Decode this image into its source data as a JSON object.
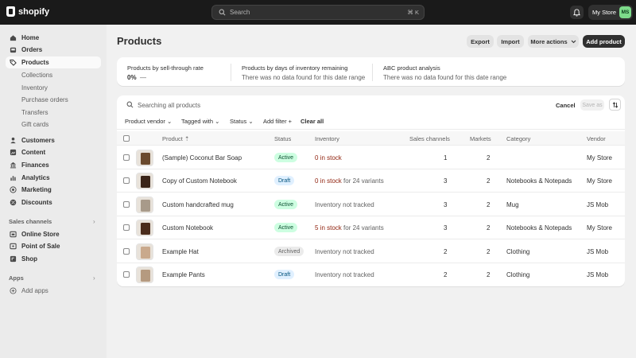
{
  "topbar": {
    "brand": "shopify",
    "search_placeholder": "Search",
    "search_shortcut": "⌘ K",
    "store_name": "My Store",
    "avatar_initials": "MS"
  },
  "sidebar": {
    "items": [
      {
        "label": "Home",
        "icon": "home-icon"
      },
      {
        "label": "Orders",
        "icon": "inbox-icon"
      },
      {
        "label": "Products",
        "icon": "tag-icon"
      },
      {
        "label": "Customers",
        "icon": "person-icon"
      },
      {
        "label": "Content",
        "icon": "content-icon"
      },
      {
        "label": "Finances",
        "icon": "bank-icon"
      },
      {
        "label": "Analytics",
        "icon": "chart-icon"
      },
      {
        "label": "Marketing",
        "icon": "target-icon"
      },
      {
        "label": "Discounts",
        "icon": "discount-icon"
      }
    ],
    "product_sub": [
      "Collections",
      "Inventory",
      "Purchase orders",
      "Transfers",
      "Gift cards"
    ],
    "sales_channels_title": "Sales channels",
    "sales_channels": [
      {
        "label": "Online Store",
        "icon": "store-icon"
      },
      {
        "label": "Point of Sale",
        "icon": "pos-icon"
      },
      {
        "label": "Shop",
        "icon": "shop-icon"
      }
    ],
    "apps_title": "Apps",
    "add_apps": "Add apps"
  },
  "main": {
    "title": "Products",
    "buttons": {
      "export": "Export",
      "import": "Import",
      "more": "More actions",
      "add": "Add product"
    },
    "analytics": [
      {
        "label": "Products by sell-through rate",
        "value": "0%",
        "suffix": "—"
      },
      {
        "label": "Products by days of inventory remaining",
        "value": "There was no data found for this date range"
      },
      {
        "label": "ABC product analysis",
        "value": "There was no data found for this date range"
      }
    ],
    "search_placeholder": "Searching all products",
    "cancel": "Cancel",
    "save_as": "Save as",
    "filters": [
      "Product vendor",
      "Tagged with",
      "Status",
      "Add filter +"
    ],
    "clear_all": "Clear all",
    "columns": {
      "product": "Product",
      "status": "Status",
      "inventory": "Inventory",
      "channels": "Sales channels",
      "markets": "Markets",
      "category": "Category",
      "vendor": "Vendor"
    },
    "rows": [
      {
        "name": "(Sample) Coconut Bar Soap",
        "status": "Active",
        "inv_red": "0 in stock",
        "inv_rest": "",
        "channels": "1",
        "markets": "2",
        "category": "",
        "vendor": "My Store",
        "thumb": "#6b4a2e"
      },
      {
        "name": "Copy of Custom Notebook",
        "status": "Draft",
        "inv_red": "0 in stock",
        "inv_rest": " for 24 variants",
        "channels": "3",
        "markets": "2",
        "category": "Notebooks & Notepads",
        "vendor": "My Store",
        "thumb": "#3a2418"
      },
      {
        "name": "Custom handcrafted mug",
        "status": "Active",
        "inv_red": "",
        "inv_rest": "Inventory not tracked",
        "channels": "3",
        "markets": "2",
        "category": "Mug",
        "vendor": "JS Mob",
        "thumb": "#a89a8a"
      },
      {
        "name": "Custom Notebook",
        "status": "Active",
        "inv_red": "5 in stock",
        "inv_rest": " for 24 variants",
        "channels": "3",
        "markets": "2",
        "category": "Notebooks & Notepads",
        "vendor": "My Store",
        "thumb": "#4a2c1c"
      },
      {
        "name": "Example Hat",
        "status": "Archived",
        "inv_red": "",
        "inv_rest": "Inventory not tracked",
        "channels": "2",
        "markets": "2",
        "category": "Clothing",
        "vendor": "JS Mob",
        "thumb": "#c9a98c"
      },
      {
        "name": "Example Pants",
        "status": "Draft",
        "inv_red": "",
        "inv_rest": "Inventory not tracked",
        "channels": "2",
        "markets": "2",
        "category": "Clothing",
        "vendor": "JS Mob",
        "thumb": "#b59a80"
      }
    ]
  }
}
